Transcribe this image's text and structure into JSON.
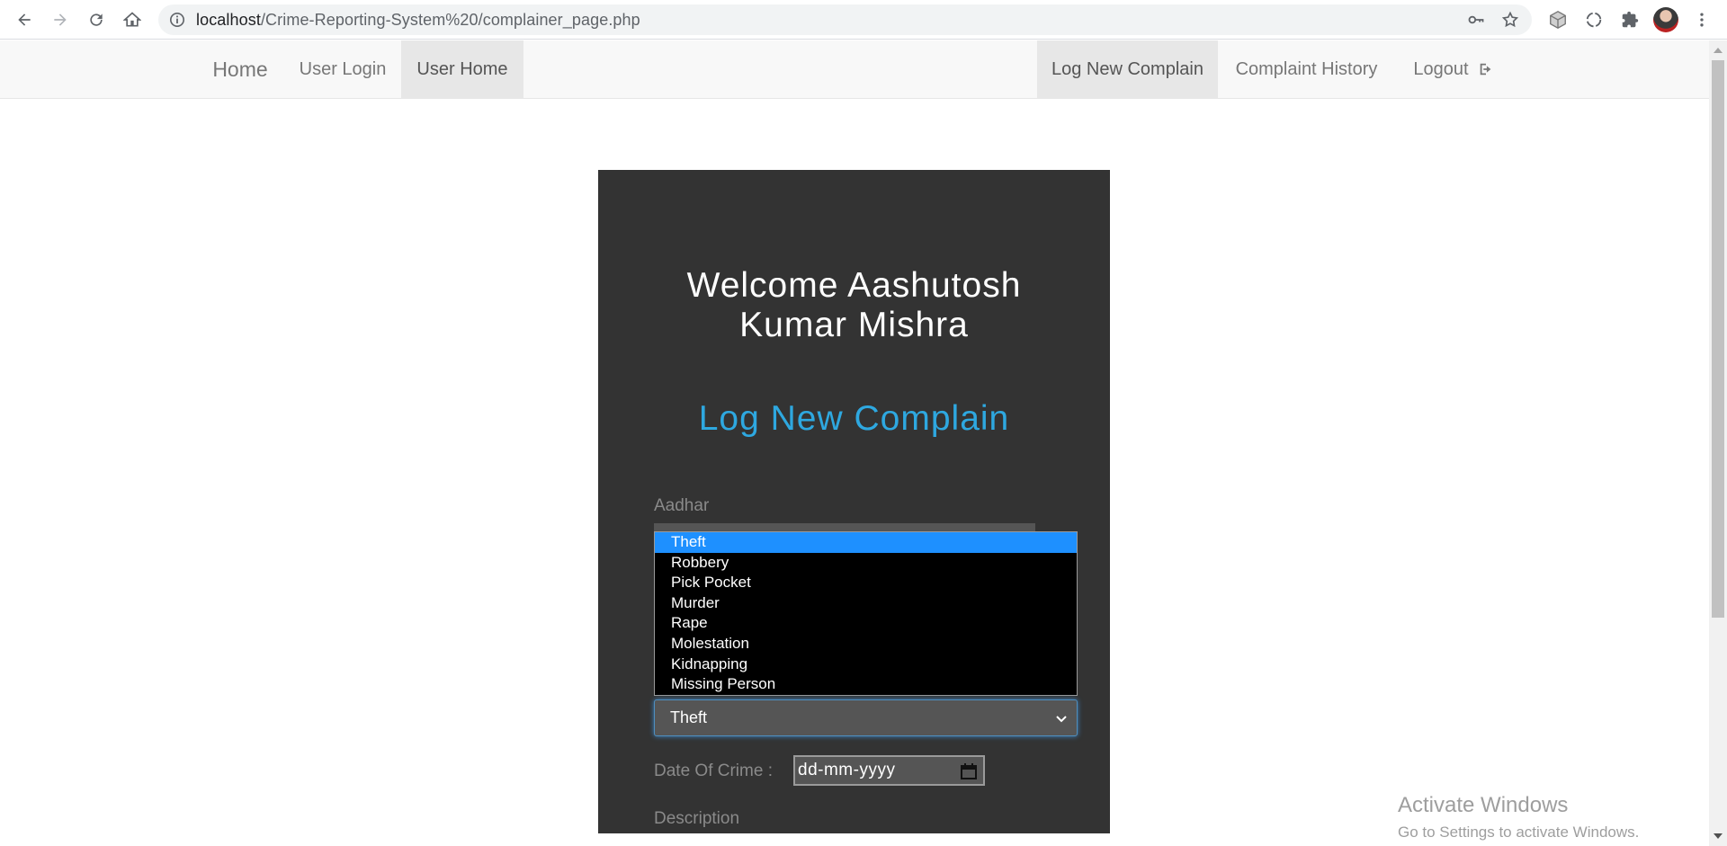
{
  "browser": {
    "url_host": "localhost",
    "url_path": "/Crime-Reporting-System%20/complainer_page.php"
  },
  "navbar": {
    "left": [
      "Home",
      "User Login",
      "User Home"
    ],
    "right": [
      "Log New Complain",
      "Complaint History",
      "Logout"
    ]
  },
  "card": {
    "welcome_line1": "Welcome Aashutosh",
    "welcome_line2": "Kumar Mishra",
    "title": "Log New Complain",
    "aadhar_label": "Aadhar",
    "crime_options": [
      "Theft",
      "Robbery",
      "Pick Pocket",
      "Murder",
      "Rape",
      "Molestation",
      "Kidnapping",
      "Missing Person"
    ],
    "crime_selected": "Theft",
    "date_label": "Date Of Crime :",
    "date_placeholder": "dd-mm-yyyy",
    "description_label": "Description"
  },
  "watermark": {
    "title": "Activate Windows",
    "subtitle": "Go to Settings to activate Windows."
  },
  "colors": {
    "card_bg": "#333333",
    "title_blue": "#2ea8e0",
    "option_highlight": "#1e90ff"
  }
}
